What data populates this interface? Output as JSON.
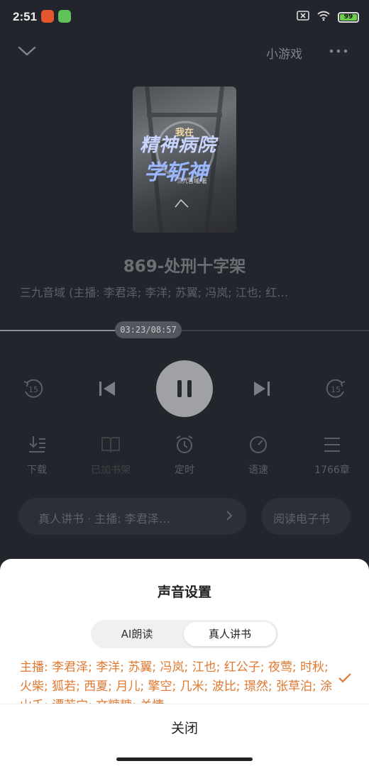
{
  "status": {
    "time": "2:51",
    "battery": "99"
  },
  "topbar": {
    "minigame": "小游戏"
  },
  "book": {
    "cover_top": "我在",
    "cover_line1": "精神病院",
    "cover_line2": "学斩神",
    "cover_author": "三九音域/著",
    "chapter": "869-处刑十字架",
    "artists": "三九音域 (主播: 李君泽; 李洋; 苏翼; 冯岚; 江也; 红…"
  },
  "player": {
    "time": "03:23/08:57",
    "progress": 0.38
  },
  "tools": [
    {
      "label": "下载",
      "icon": "download-icon"
    },
    {
      "label": "已加书架",
      "icon": "bookshelf-icon"
    },
    {
      "label": "定时",
      "icon": "alarm-icon"
    },
    {
      "label": "语速",
      "icon": "speed-icon"
    },
    {
      "label": "1766章",
      "icon": "list-icon"
    }
  ],
  "pills": {
    "narrator": "真人讲书 · 主播: 李君泽…",
    "ebook": "阅读电子书"
  },
  "sheet": {
    "title": "声音设置",
    "seg_ai": "AI朗读",
    "seg_human": "真人讲书",
    "cast": "主播: 李君泽; 李洋; 苏翼; 冯岚; 江也; 红公子; 夜莺; 时秋; 火柴; 狐若; 西夏; 月儿; 擎空; 几米; 波比; 璟然; 张草泊; 涂山壬; 谭若宁; 文糖糖; 关情",
    "close": "关闭"
  },
  "colors": {
    "accent": "#e0782f"
  }
}
